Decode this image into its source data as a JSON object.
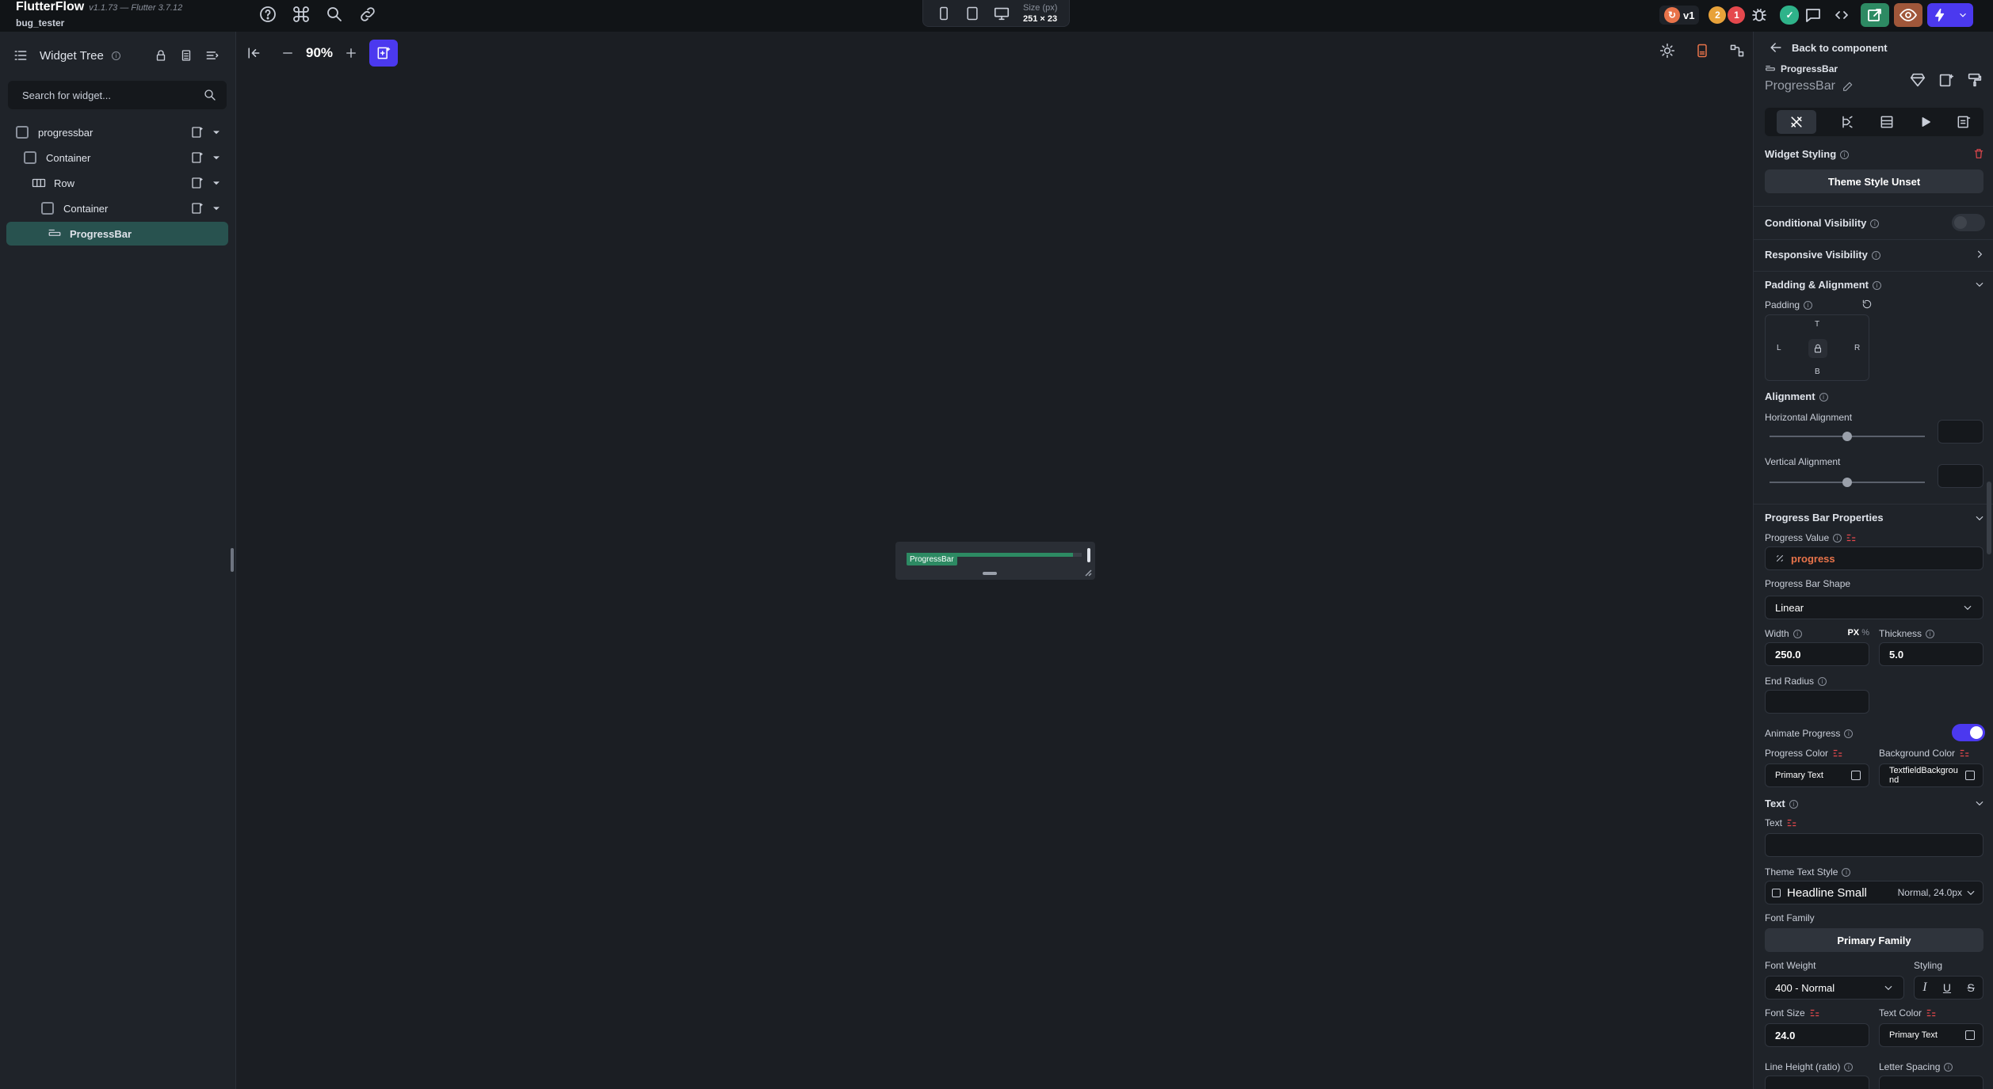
{
  "app": {
    "name": "FlutterFlow",
    "version": "v1.1.73 — Flutter 3.7.12",
    "project": "bug_tester"
  },
  "device_bar": {
    "size_label": "Size (px)",
    "size_value": "251 × 23"
  },
  "top_right": {
    "version_badge": "v1",
    "badge_orange": "2",
    "badge_red": "1"
  },
  "left_panel": {
    "title": "Widget Tree",
    "search_placeholder": "Search for widget...",
    "tree": [
      {
        "label": "progressbar"
      },
      {
        "label": "Container"
      },
      {
        "label": "Row"
      },
      {
        "label": "Container"
      },
      {
        "label": "ProgressBar"
      }
    ]
  },
  "canvas": {
    "zoom": "90%",
    "component_tag": "ProgressBar",
    "progress_fraction": 0.95
  },
  "right_panel": {
    "back_label": "Back to component",
    "component_type": "ProgressBar",
    "component_name": "ProgressBar",
    "widget_styling": "Widget Styling",
    "theme_style_btn": "Theme Style Unset",
    "conditional_visibility": "Conditional Visibility",
    "responsive_visibility": "Responsive Visibility",
    "padding_alignment": "Padding & Alignment",
    "padding": "Padding",
    "pad_t": "T",
    "pad_l": "L",
    "pad_r": "R",
    "pad_b": "B",
    "alignment": "Alignment",
    "horizontal_alignment": "Horizontal Alignment",
    "vertical_alignment": "Vertical Alignment",
    "progress_bar_properties": "Progress Bar Properties",
    "progress_value": "Progress Value",
    "progress_value_var": "progress",
    "progress_bar_shape": "Progress Bar Shape",
    "shape_value": "Linear",
    "width": "Width",
    "unit_px": "PX",
    "unit_pct": "%",
    "width_value": "250.0",
    "thickness": "Thickness",
    "thickness_value": "5.0",
    "end_radius": "End Radius",
    "animate_progress": "Animate Progress",
    "progress_color": "Progress Color",
    "progress_color_value": "Primary Text",
    "background_color": "Background Color",
    "background_color_value": "TextfieldBackground",
    "text_section": "Text",
    "text_label": "Text",
    "theme_text_style": "Theme Text Style",
    "text_style_value": "Headline Small",
    "text_style_meta": "Normal, 24.0px",
    "font_family": "Font Family",
    "font_family_btn": "Primary Family",
    "font_weight": "Font Weight",
    "font_weight_value": "400 - Normal",
    "styling": "Styling",
    "font_size": "Font Size",
    "font_size_value": "24.0",
    "text_color": "Text Color",
    "text_color_value": "Primary Text",
    "line_height": "Line Height (ratio)",
    "letter_spacing": "Letter Spacing"
  },
  "colors": {
    "accent": "#4b39ef",
    "brand_green": "#2d8a63",
    "danger": "#e5484d"
  }
}
